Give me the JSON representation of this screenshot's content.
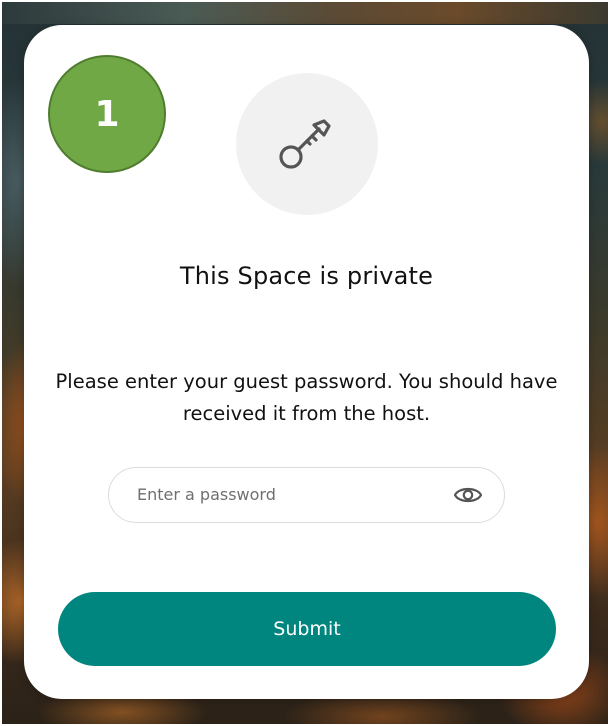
{
  "step_badge": {
    "number": "1",
    "color": "#70a846"
  },
  "dialog": {
    "icon": "key-icon",
    "title": "This Space is private",
    "instructions": "Please enter your guest password. You should have received it from the host."
  },
  "password": {
    "placeholder": "Enter a password",
    "value": "",
    "toggle_icon": "eye-icon"
  },
  "submit": {
    "label": "Submit",
    "color": "#00867e"
  }
}
